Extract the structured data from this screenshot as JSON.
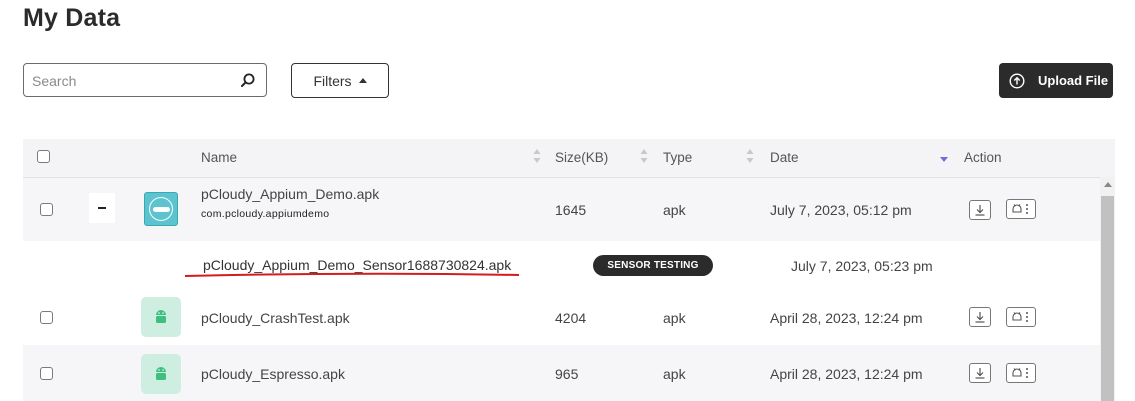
{
  "page": {
    "title": "My Data"
  },
  "toolbar": {
    "search_placeholder": "Search",
    "filters_label": "Filters",
    "upload_label": "Upload File"
  },
  "table": {
    "headers": {
      "name": "Name",
      "size": "Size(KB)",
      "type": "Type",
      "date": "Date",
      "action": "Action"
    },
    "rows": [
      {
        "name": "pCloudy_Appium_Demo.apk",
        "package": "com.pcloudy.appiumdemo",
        "size": "1645",
        "type": "apk",
        "date": "July 7, 2023, 05:12 pm",
        "icon": "pcloudy-logo-icon"
      },
      {
        "name": "pCloudy_Appium_Demo_Sensor1688730824.apk",
        "badge": "SENSOR TESTING",
        "date": "July 7, 2023, 05:23 pm"
      },
      {
        "name": "pCloudy_CrashTest.apk",
        "size": "4204",
        "type": "apk",
        "date": "April 28, 2023, 12:24 pm",
        "icon": "android-icon"
      },
      {
        "name": "pCloudy_Espresso.apk",
        "size": "965",
        "type": "apk",
        "date": "April 28, 2023, 12:24 pm",
        "icon": "android-icon"
      }
    ]
  },
  "colors": {
    "accent_dark": "#2b2b2b",
    "row_alt": "#f6f6f8",
    "annotation_red": "#d41c1c",
    "sort_active": "#6f6fd8"
  }
}
